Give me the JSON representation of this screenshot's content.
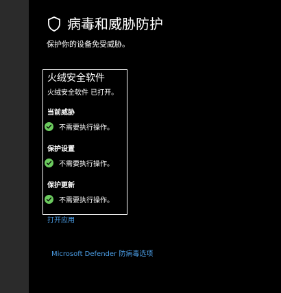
{
  "page": {
    "title": "病毒和威胁防护",
    "subtitle": "保护你的设备免受威胁。"
  },
  "provider": {
    "name": "火绒安全软件",
    "status": "火绒安全软件 已打开。",
    "sections": [
      {
        "heading": "当前威胁",
        "status": "不需要执行操作。"
      },
      {
        "heading": "保护设置",
        "status": "不需要执行操作。"
      },
      {
        "heading": "保护更新",
        "status": "不需要执行操作。"
      }
    ],
    "open_app_link": "打开应用"
  },
  "footer": {
    "defender_link": "Microsoft Defender 防病毒选项"
  },
  "icons": {
    "title": "shield-icon",
    "status": "check-circle-icon"
  },
  "colors": {
    "background": "#000000",
    "left_strip": "#2b2b2b",
    "link": "#4c9fe8",
    "ok": "#6ccb5f"
  }
}
